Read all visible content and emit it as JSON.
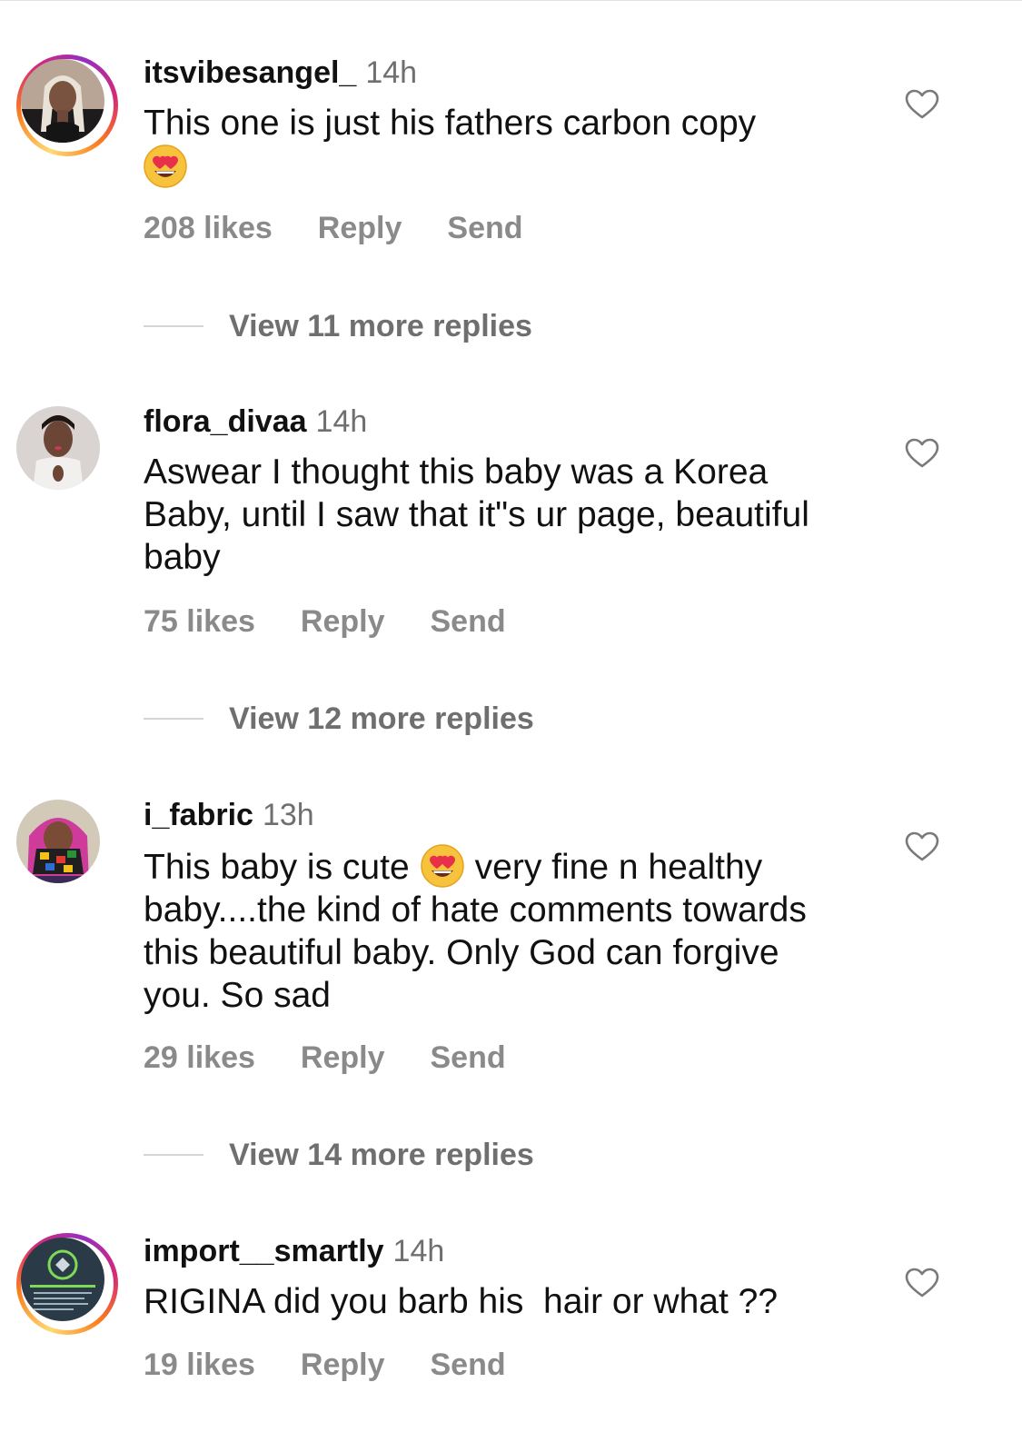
{
  "comments": [
    {
      "username": "itsvibesangel_",
      "time": "14h",
      "text_before": "This one is just his fathers carbon copy",
      "emoji": "heart-eyes",
      "text_after": "",
      "likes": "208 likes",
      "reply": "Reply",
      "send": "Send",
      "view_replies": "View 11 more replies"
    },
    {
      "username": "flora_divaa",
      "time": "14h",
      "text_before": "Aswear I thought this baby was a Korea Baby, until I saw that it\"s ur page, beautiful baby",
      "likes": "75 likes",
      "reply": "Reply",
      "send": "Send",
      "view_replies": "View 12 more replies"
    },
    {
      "username": "i_fabric",
      "time": "13h",
      "text_before": "This baby is cute",
      "emoji": "heart-eyes",
      "text_after": "very fine n healthy baby....the kind of hate comments towards this beautiful baby. Only God can forgive you. So sad",
      "likes": "29 likes",
      "reply": "Reply",
      "send": "Send",
      "view_replies": "View 14 more replies"
    },
    {
      "username": "import__smartly",
      "time": "14h",
      "text_before": "RIGINA did you barb his  hair or what ??",
      "likes": "19 likes",
      "reply": "Reply",
      "send": "Send",
      "avatar_logo_text": "IMPORT SMARTLY"
    }
  ],
  "icons": {
    "like": "heart-outline-icon",
    "emoji": "smiling-face-with-heart-eyes"
  },
  "colors": {
    "story_ring": [
      "#feda75",
      "#fa7e1e",
      "#d62976",
      "#962fbf"
    ],
    "secondary_text": "#8a8a8a"
  }
}
